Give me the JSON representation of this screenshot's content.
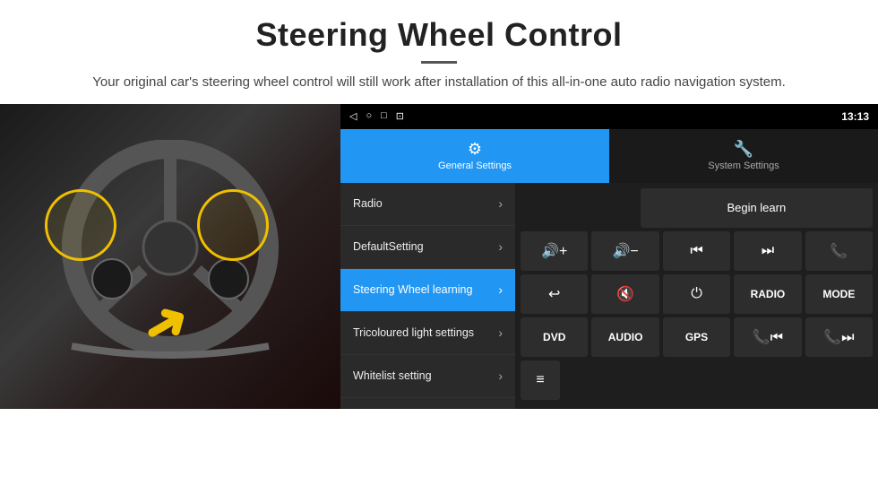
{
  "header": {
    "title": "Steering Wheel Control",
    "divider": true,
    "subtitle": "Your original car's steering wheel control will still work after installation of this all-in-one auto radio navigation system."
  },
  "android_ui": {
    "status_bar": {
      "nav_icons": [
        "◁",
        "○",
        "□",
        "⊡"
      ],
      "time": "13:13",
      "signal_icons": "▾ ▾"
    },
    "tabs": [
      {
        "label": "General Settings",
        "icon": "⚙",
        "active": true
      },
      {
        "label": "System Settings",
        "icon": "⚙",
        "active": false
      }
    ],
    "menu_items": [
      {
        "label": "Radio",
        "active": false
      },
      {
        "label": "DefaultSetting",
        "active": false
      },
      {
        "label": "Steering Wheel learning",
        "active": true
      },
      {
        "label": "Tricoloured light settings",
        "active": false
      },
      {
        "label": "Whitelist setting",
        "active": false
      }
    ],
    "controls": {
      "begin_learn_label": "Begin learn",
      "row1": [
        {
          "icon": "🔊+",
          "label": "vol+"
        },
        {
          "icon": "🔊-",
          "label": "vol-"
        },
        {
          "icon": "⏮",
          "label": "prev"
        },
        {
          "icon": "⏭",
          "label": "next"
        },
        {
          "icon": "📞",
          "label": "call"
        }
      ],
      "row2": [
        {
          "icon": "↩",
          "label": "back"
        },
        {
          "icon": "🔊×",
          "label": "mute"
        },
        {
          "icon": "⏻",
          "label": "power"
        },
        {
          "label": "RADIO",
          "text": true
        },
        {
          "label": "MODE",
          "text": true
        }
      ],
      "row3": [
        {
          "label": "DVD",
          "text": true
        },
        {
          "label": "AUDIO",
          "text": true
        },
        {
          "label": "GPS",
          "text": true
        },
        {
          "icon": "📞⏮",
          "label": "call-prev"
        },
        {
          "icon": "📞⏭",
          "label": "call-next"
        }
      ],
      "row4": [
        {
          "icon": "≡",
          "label": "menu"
        }
      ]
    }
  }
}
